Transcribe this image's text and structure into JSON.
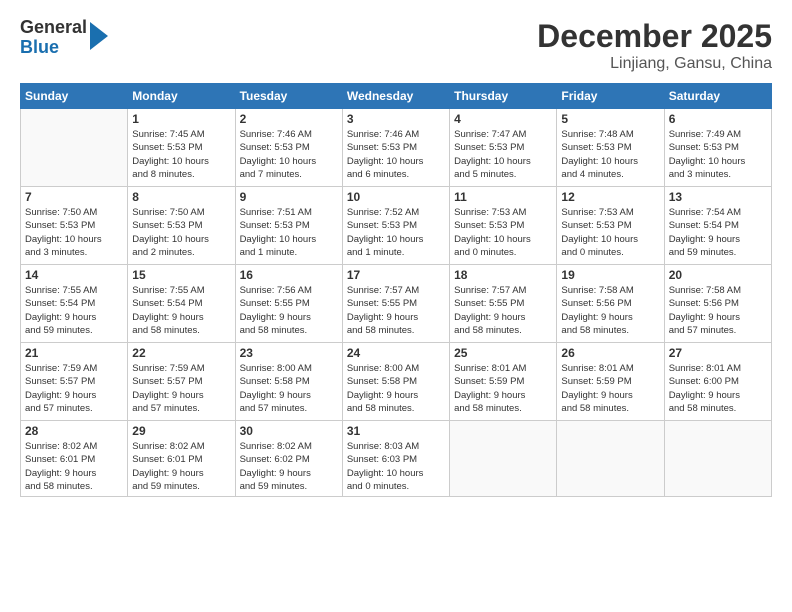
{
  "header": {
    "logo": {
      "line1": "General",
      "line2": "Blue"
    },
    "title": "December 2025",
    "subtitle": "Linjiang, Gansu, China"
  },
  "calendar": {
    "weekdays": [
      "Sunday",
      "Monday",
      "Tuesday",
      "Wednesday",
      "Thursday",
      "Friday",
      "Saturday"
    ],
    "weeks": [
      [
        {
          "day": "",
          "info": ""
        },
        {
          "day": "1",
          "info": "Sunrise: 7:45 AM\nSunset: 5:53 PM\nDaylight: 10 hours\nand 8 minutes."
        },
        {
          "day": "2",
          "info": "Sunrise: 7:46 AM\nSunset: 5:53 PM\nDaylight: 10 hours\nand 7 minutes."
        },
        {
          "day": "3",
          "info": "Sunrise: 7:46 AM\nSunset: 5:53 PM\nDaylight: 10 hours\nand 6 minutes."
        },
        {
          "day": "4",
          "info": "Sunrise: 7:47 AM\nSunset: 5:53 PM\nDaylight: 10 hours\nand 5 minutes."
        },
        {
          "day": "5",
          "info": "Sunrise: 7:48 AM\nSunset: 5:53 PM\nDaylight: 10 hours\nand 4 minutes."
        },
        {
          "day": "6",
          "info": "Sunrise: 7:49 AM\nSunset: 5:53 PM\nDaylight: 10 hours\nand 3 minutes."
        }
      ],
      [
        {
          "day": "7",
          "info": "Sunrise: 7:50 AM\nSunset: 5:53 PM\nDaylight: 10 hours\nand 3 minutes."
        },
        {
          "day": "8",
          "info": "Sunrise: 7:50 AM\nSunset: 5:53 PM\nDaylight: 10 hours\nand 2 minutes."
        },
        {
          "day": "9",
          "info": "Sunrise: 7:51 AM\nSunset: 5:53 PM\nDaylight: 10 hours\nand 1 minute."
        },
        {
          "day": "10",
          "info": "Sunrise: 7:52 AM\nSunset: 5:53 PM\nDaylight: 10 hours\nand 1 minute."
        },
        {
          "day": "11",
          "info": "Sunrise: 7:53 AM\nSunset: 5:53 PM\nDaylight: 10 hours\nand 0 minutes."
        },
        {
          "day": "12",
          "info": "Sunrise: 7:53 AM\nSunset: 5:53 PM\nDaylight: 10 hours\nand 0 minutes."
        },
        {
          "day": "13",
          "info": "Sunrise: 7:54 AM\nSunset: 5:54 PM\nDaylight: 9 hours\nand 59 minutes."
        }
      ],
      [
        {
          "day": "14",
          "info": "Sunrise: 7:55 AM\nSunset: 5:54 PM\nDaylight: 9 hours\nand 59 minutes."
        },
        {
          "day": "15",
          "info": "Sunrise: 7:55 AM\nSunset: 5:54 PM\nDaylight: 9 hours\nand 58 minutes."
        },
        {
          "day": "16",
          "info": "Sunrise: 7:56 AM\nSunset: 5:55 PM\nDaylight: 9 hours\nand 58 minutes."
        },
        {
          "day": "17",
          "info": "Sunrise: 7:57 AM\nSunset: 5:55 PM\nDaylight: 9 hours\nand 58 minutes."
        },
        {
          "day": "18",
          "info": "Sunrise: 7:57 AM\nSunset: 5:55 PM\nDaylight: 9 hours\nand 58 minutes."
        },
        {
          "day": "19",
          "info": "Sunrise: 7:58 AM\nSunset: 5:56 PM\nDaylight: 9 hours\nand 58 minutes."
        },
        {
          "day": "20",
          "info": "Sunrise: 7:58 AM\nSunset: 5:56 PM\nDaylight: 9 hours\nand 57 minutes."
        }
      ],
      [
        {
          "day": "21",
          "info": "Sunrise: 7:59 AM\nSunset: 5:57 PM\nDaylight: 9 hours\nand 57 minutes."
        },
        {
          "day": "22",
          "info": "Sunrise: 7:59 AM\nSunset: 5:57 PM\nDaylight: 9 hours\nand 57 minutes."
        },
        {
          "day": "23",
          "info": "Sunrise: 8:00 AM\nSunset: 5:58 PM\nDaylight: 9 hours\nand 57 minutes."
        },
        {
          "day": "24",
          "info": "Sunrise: 8:00 AM\nSunset: 5:58 PM\nDaylight: 9 hours\nand 58 minutes."
        },
        {
          "day": "25",
          "info": "Sunrise: 8:01 AM\nSunset: 5:59 PM\nDaylight: 9 hours\nand 58 minutes."
        },
        {
          "day": "26",
          "info": "Sunrise: 8:01 AM\nSunset: 5:59 PM\nDaylight: 9 hours\nand 58 minutes."
        },
        {
          "day": "27",
          "info": "Sunrise: 8:01 AM\nSunset: 6:00 PM\nDaylight: 9 hours\nand 58 minutes."
        }
      ],
      [
        {
          "day": "28",
          "info": "Sunrise: 8:02 AM\nSunset: 6:01 PM\nDaylight: 9 hours\nand 58 minutes."
        },
        {
          "day": "29",
          "info": "Sunrise: 8:02 AM\nSunset: 6:01 PM\nDaylight: 9 hours\nand 59 minutes."
        },
        {
          "day": "30",
          "info": "Sunrise: 8:02 AM\nSunset: 6:02 PM\nDaylight: 9 hours\nand 59 minutes."
        },
        {
          "day": "31",
          "info": "Sunrise: 8:03 AM\nSunset: 6:03 PM\nDaylight: 10 hours\nand 0 minutes."
        },
        {
          "day": "",
          "info": ""
        },
        {
          "day": "",
          "info": ""
        },
        {
          "day": "",
          "info": ""
        }
      ]
    ]
  }
}
